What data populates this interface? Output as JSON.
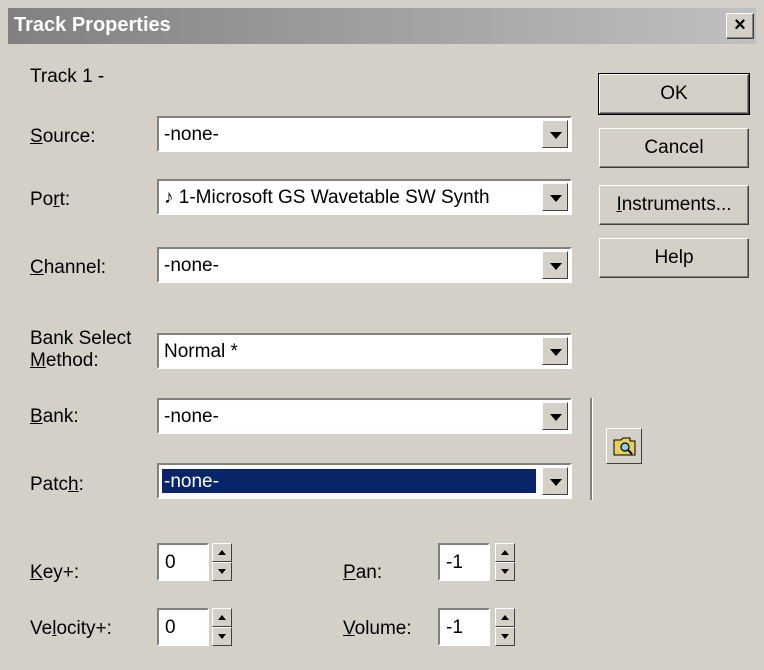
{
  "window": {
    "title": "Track Properties",
    "close_glyph": "×"
  },
  "track_label": "Track 1 -",
  "fields": {
    "source": {
      "label_u": "S",
      "label_rest": "ource:",
      "value": "-none-"
    },
    "port": {
      "label_pre": "Po",
      "label_u": "r",
      "label_rest": "t:",
      "value": "♪ 1-Microsoft GS Wavetable SW Synth"
    },
    "channel": {
      "label_u": "C",
      "label_rest": "hannel:",
      "value": "-none-"
    },
    "bank_select": {
      "label_line1": "Bank Select",
      "label_u": "M",
      "label_rest": "ethod:",
      "value": "Normal  *"
    },
    "bank": {
      "label_u": "B",
      "label_rest": "ank:",
      "value": "-none-"
    },
    "patch": {
      "label_pre": "Patc",
      "label_u": "h",
      "label_rest": ":",
      "value": "-none-"
    }
  },
  "buttons": {
    "ok": "OK",
    "cancel": "Cancel",
    "instruments": "Instruments...",
    "instruments_u": "I",
    "instruments_rest": "nstruments...",
    "help": "Help"
  },
  "spinners": {
    "key": {
      "label_u": "K",
      "label_rest": "ey+:",
      "value": "0"
    },
    "velocity": {
      "label_pre": "Ve",
      "label_u": "l",
      "label_rest": "ocity+:",
      "value": "0"
    },
    "pan": {
      "label_u": "P",
      "label_rest": "an:",
      "value": "-1"
    },
    "volume": {
      "label_u": "V",
      "label_rest": "olume:",
      "value": "-1"
    }
  },
  "icons": {
    "browse": "folder-search-icon"
  }
}
